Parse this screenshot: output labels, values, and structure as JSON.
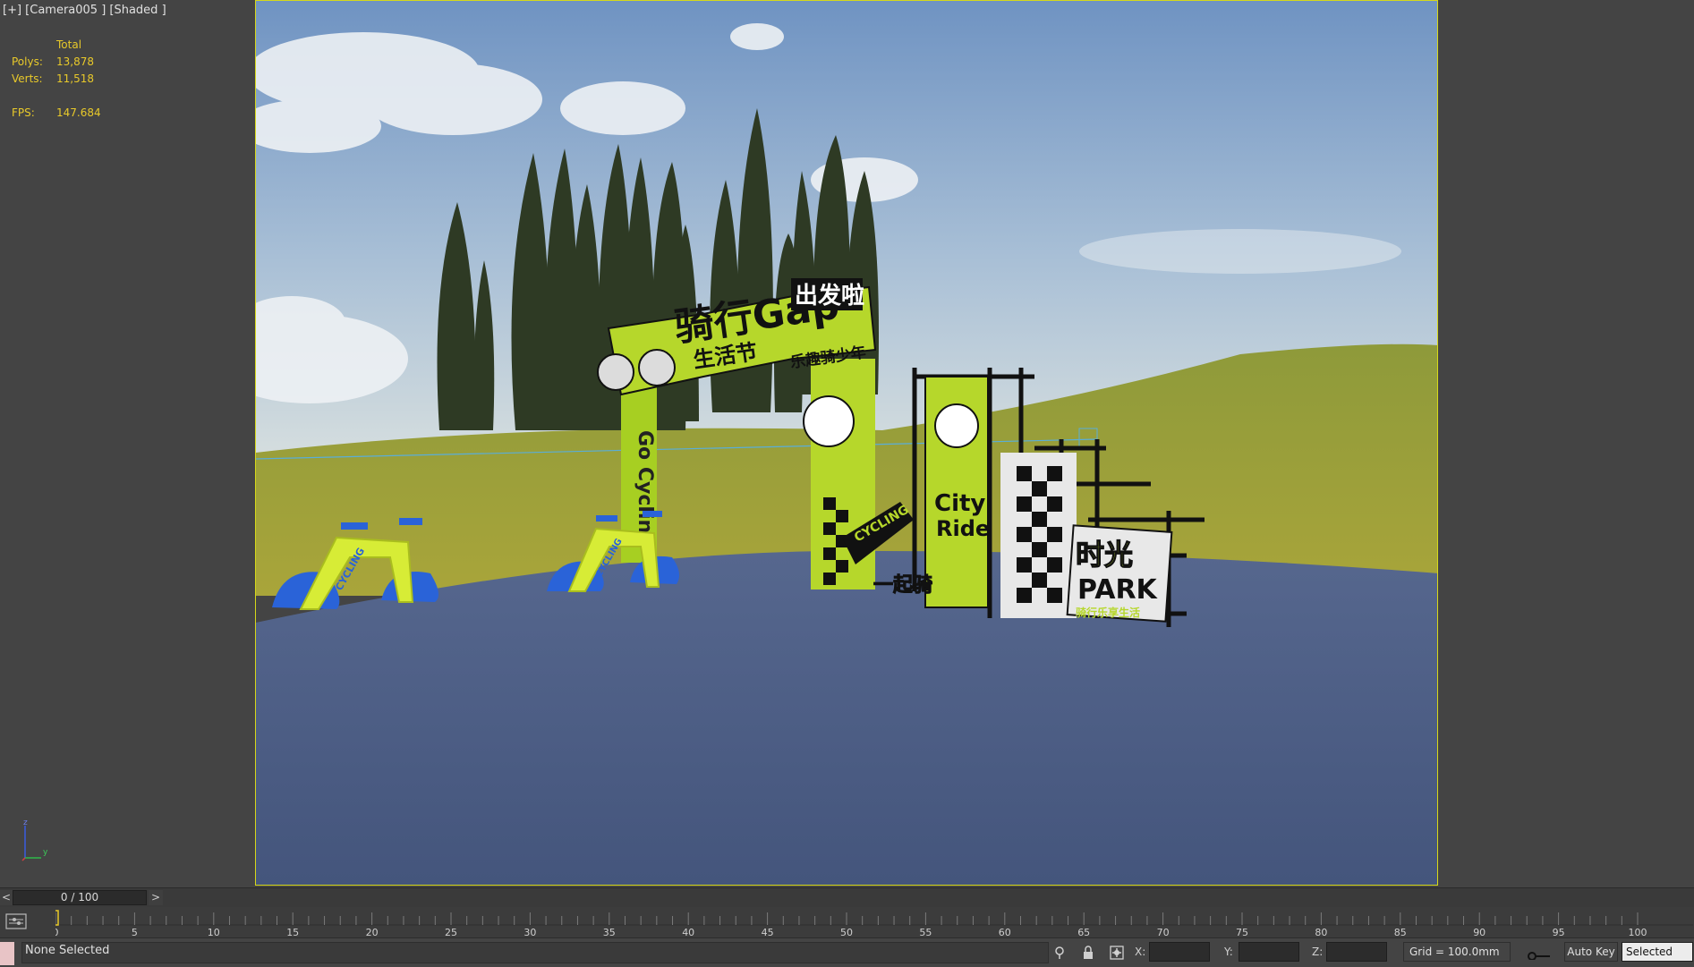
{
  "viewport": {
    "label": "[+] [Camera005 ] [Shaded ]",
    "stats": {
      "header": "Total",
      "polys_label": "Polys:",
      "polys_value": "13,878",
      "verts_label": "Verts:",
      "verts_value": "11,518",
      "fps_label": "FPS:",
      "fps_value": "147.684"
    },
    "axis": {
      "z": "z",
      "y": "y"
    }
  },
  "scene": {
    "arch_title": "骑行Gap",
    "arch_subtitle": "生活节",
    "arch_badge": "出发啦",
    "arch_slogan": "乐趣骑少年",
    "pillar_left_text": "Go Cycling",
    "sign_city": "City",
    "sign_ride": "Ride",
    "sign_cycling": "CYCLING",
    "sign_yiqi": "一起骑",
    "sign_park_cn": "时光",
    "sign_park": "PARK",
    "sign_park_sub": "骑行乐享生活",
    "bike_text": "CYCLING"
  },
  "timeslider": {
    "prev_label": "<",
    "position_label": "0 / 100",
    "next_label": ">"
  },
  "trackbar": {
    "ticks": [
      "0",
      "5",
      "10",
      "15",
      "20",
      "25",
      "30",
      "35",
      "40",
      "45",
      "50",
      "55",
      "60",
      "65",
      "70",
      "75",
      "80",
      "85",
      "90",
      "95",
      "100"
    ]
  },
  "statusbar": {
    "selection_text": "None Selected",
    "x_label": "X:",
    "y_label": "Y:",
    "z_label": "Z:",
    "grid_text": "Grid = 100.0mm",
    "autokey_label": "Auto Key",
    "selection_set_value": "Selected"
  },
  "colors": {
    "viewport_border": "#d6d81a",
    "stats_text": "#e8c92a",
    "sign_green": "#b6d72b",
    "bike_blue": "#2a63d8",
    "ground": "#4b5d86",
    "sky": "#8aa7c9"
  }
}
